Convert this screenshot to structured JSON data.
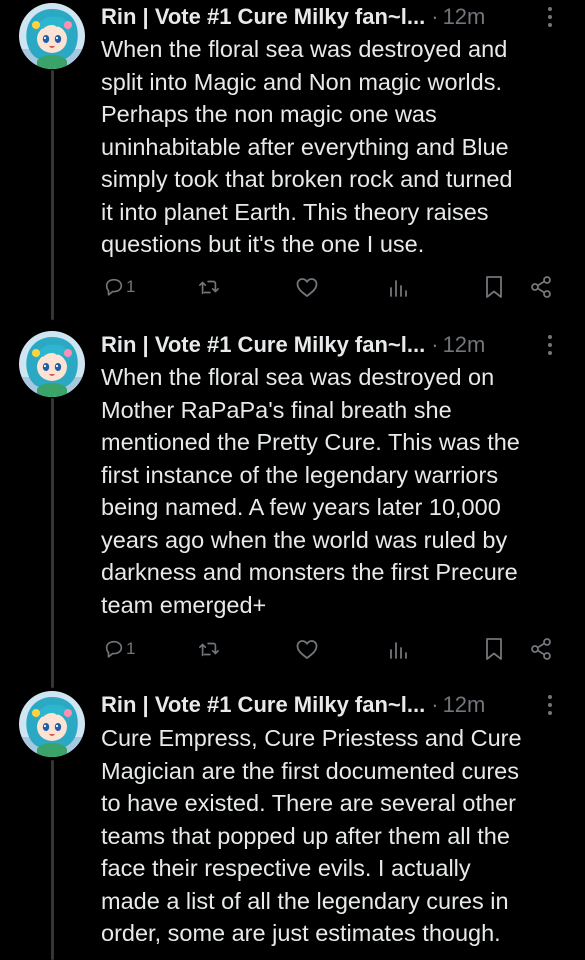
{
  "colors": {
    "background": "#000000",
    "text": "#e7e9ea",
    "secondary": "#71767b",
    "thread_line": "#333639"
  },
  "tweets": [
    {
      "author": "Rin | Vote #1 Cure Milky fan~l...",
      "separator": "·",
      "time": "12m",
      "text": "When the floral sea was destroyed and\nsplit into Magic and Non magic worlds.\nPerhaps the non magic one was\nuninhabitable after everything and Blue\nsimply took that broken rock and turned\nit into planet Earth. This theory raises\nquestions but it's the one I use.",
      "reply_count": "1",
      "icons": [
        "more-icon",
        "reply-icon",
        "retweet-icon",
        "like-icon",
        "views-icon",
        "bookmark-icon",
        "share-icon"
      ]
    },
    {
      "author": "Rin | Vote #1 Cure Milky fan~l...",
      "separator": "·",
      "time": "12m",
      "text": "When the floral sea was destroyed on\nMother RaPaPa's final breath she\nmentioned the Pretty Cure. This was the\nfirst instance of the legendary warriors\nbeing named. A few years later 10,000\nyears ago when the world was ruled by\ndarkness and monsters the first Precure\nteam emerged+",
      "reply_count": "1",
      "icons": [
        "more-icon",
        "reply-icon",
        "retweet-icon",
        "like-icon",
        "views-icon",
        "bookmark-icon",
        "share-icon"
      ]
    },
    {
      "author": "Rin | Vote #1 Cure Milky fan~l...",
      "separator": "·",
      "time": "12m",
      "text": "Cure Empress, Cure Priestess and Cure\nMagician are the first documented cures\nto have existed. There are several other\nteams that popped up after them all the\nface their respective evils. I actually\nmade a list of all the legendary cures in\norder, some are just estimates though.",
      "icons": [
        "more-icon"
      ]
    }
  ]
}
